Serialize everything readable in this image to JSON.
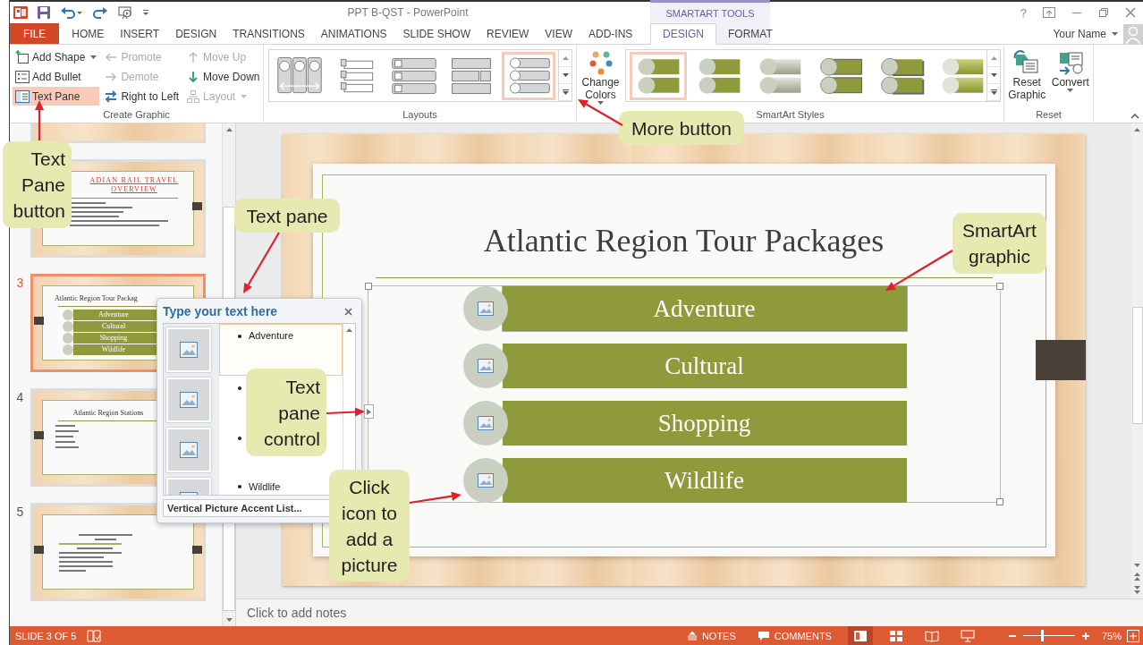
{
  "window": {
    "title": "PPT B-QST - PowerPoint",
    "contextual_group": "SMARTART TOOLS",
    "help": "?",
    "user_name": "Your Name"
  },
  "tabs": [
    {
      "label": "FILE",
      "kind": "file",
      "selected": false
    },
    {
      "label": "HOME",
      "kind": "main",
      "selected": false
    },
    {
      "label": "INSERT",
      "kind": "main",
      "selected": false
    },
    {
      "label": "DESIGN",
      "kind": "main",
      "selected": false
    },
    {
      "label": "TRANSITIONS",
      "kind": "main",
      "selected": false
    },
    {
      "label": "ANIMATIONS",
      "kind": "main",
      "selected": false
    },
    {
      "label": "SLIDE SHOW",
      "kind": "main",
      "selected": false
    },
    {
      "label": "REVIEW",
      "kind": "main",
      "selected": false
    },
    {
      "label": "VIEW",
      "kind": "main",
      "selected": false
    },
    {
      "label": "ADD-INS",
      "kind": "main",
      "selected": false
    },
    {
      "label": "DESIGN",
      "kind": "contextual",
      "selected": true
    },
    {
      "label": "FORMAT",
      "kind": "contextual",
      "selected": false
    }
  ],
  "create_graphic": {
    "title": "Create Graphic",
    "columns": [
      [
        {
          "label": "Add Shape",
          "kind": "addshape",
          "dropdown": true,
          "disabled": false,
          "selected": false
        },
        {
          "label": "Add Bullet",
          "kind": "addbullet",
          "dropdown": false,
          "disabled": false,
          "selected": false
        },
        {
          "label": "Text Pane",
          "kind": "textpane",
          "dropdown": false,
          "disabled": false,
          "selected": true
        }
      ],
      [
        {
          "label": "Promote",
          "kind": "promote",
          "dropdown": false,
          "disabled": true,
          "selected": false
        },
        {
          "label": "Demote",
          "kind": "demote",
          "dropdown": false,
          "disabled": true,
          "selected": false
        },
        {
          "label": "Right to Left",
          "kind": "righttoleft",
          "dropdown": false,
          "disabled": false,
          "selected": false
        }
      ],
      [
        {
          "label": "Move Up",
          "kind": "moveup",
          "dropdown": false,
          "disabled": true,
          "selected": false
        },
        {
          "label": "Move Down",
          "kind": "movedown",
          "dropdown": false,
          "disabled": false,
          "selected": false
        },
        {
          "label": "Layout",
          "kind": "layout",
          "dropdown": true,
          "disabled": true,
          "selected": false
        }
      ]
    ]
  },
  "layouts": {
    "title": "Layouts",
    "items": [
      {
        "kind": "columns",
        "selected": false
      },
      {
        "kind": "tabs",
        "selected": false
      },
      {
        "kind": "rows",
        "selected": false
      },
      {
        "kind": "blocks",
        "selected": false
      },
      {
        "kind": "circles",
        "selected": true
      }
    ]
  },
  "styles": {
    "title": "SmartArt Styles",
    "change_colors": "Change Colors",
    "items": [
      {
        "kind": "flat",
        "selected": true
      },
      {
        "kind": "subtle",
        "selected": false
      },
      {
        "kind": "gradient",
        "selected": false
      },
      {
        "kind": "inset",
        "selected": false
      },
      {
        "kind": "shadow",
        "selected": false
      },
      {
        "kind": "glossy",
        "selected": false
      }
    ]
  },
  "reset": {
    "title": "Reset",
    "commands": [
      {
        "label": "Reset Graphic",
        "kind": "reset",
        "dropdown": false
      },
      {
        "label": "Convert",
        "kind": "convert",
        "dropdown": true
      }
    ]
  },
  "slides": [
    {
      "kind": "partial",
      "selected": false
    },
    {
      "kind": "overview",
      "title_lines": [
        "ADIAN RAIL TRAVEL",
        "OVERVIEW"
      ],
      "selected": false
    },
    {
      "number": "3",
      "kind": "smartart",
      "title": "Atlantic Region Tour Packag",
      "items": [
        "Adventure",
        "Cultural",
        "Shopping",
        "Wildlife"
      ],
      "selected": true
    },
    {
      "number": "4",
      "kind": "bullets",
      "title": "Atlantic Region Stations",
      "selected": false
    },
    {
      "number": "5",
      "kind": "smalltext",
      "selected": false
    }
  ],
  "slide": {
    "title": "Atlantic Region Tour Packages",
    "items": [
      "Adventure",
      "Cultural",
      "Shopping",
      "Wildlife"
    ]
  },
  "text_pane": {
    "title": "Type your text here",
    "bullets": [
      {
        "text": "Adventure",
        "selected": true
      },
      {
        "selected": false
      },
      {
        "selected": false
      },
      {
        "text": "Wildlife",
        "selected": false
      }
    ],
    "footer": "Vertical Picture Accent List..."
  },
  "notes": {
    "placeholder": "Click to add notes"
  },
  "status_bar": {
    "slide_info": "SLIDE 3 OF 5",
    "notes": "NOTES",
    "comments": "COMMENTS",
    "views": [
      {
        "kind": "normal",
        "selected": true
      },
      {
        "kind": "sorter",
        "selected": false
      },
      {
        "kind": "reading",
        "selected": false
      },
      {
        "kind": "slideshow",
        "selected": false
      }
    ],
    "zoom": {
      "level": 0.35,
      "reading": "75%"
    }
  },
  "callouts": [
    {
      "text": "Text Pane button",
      "kind": "button"
    },
    {
      "text": "Text pane",
      "kind": "pane"
    },
    {
      "text": "More button",
      "kind": "more"
    },
    {
      "text": "SmartArt graphic",
      "kind": "graphic"
    },
    {
      "text": "Text pane control",
      "kind": "control"
    },
    {
      "text": "Click icon to add a picture",
      "kind": "picture"
    }
  ]
}
